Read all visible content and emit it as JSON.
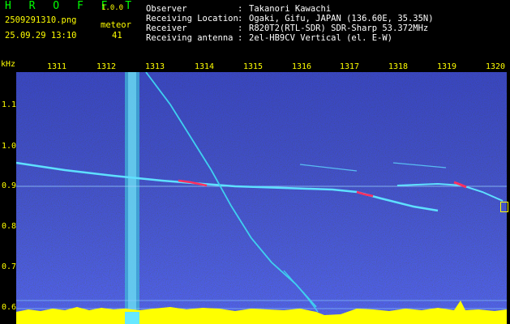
{
  "app": {
    "brand": "H R O F F T",
    "version": "1.0.0"
  },
  "file": {
    "name": "2509291310.png",
    "datetime": "25.09.29 13:10"
  },
  "meteor": {
    "label": "meteor",
    "count": "41"
  },
  "info": {
    "observer_label": "Observer",
    "observer_value": "Takanori Kawachi",
    "location_label": "Receiving Location",
    "location_value": "Ogaki, Gifu, JAPAN (136.60E, 35.35N)",
    "receiver_label": "Receiver",
    "receiver_value": "R820T2(RTL-SDR) SDR-Sharp 53.372MHz",
    "antenna_label": "Receiving antenna",
    "antenna_value": "2el-HB9CV Vertical (el. E-W)",
    "colon": ":"
  },
  "axis": {
    "y_unit": "kHz",
    "x_ticks": [
      "1311",
      "1312",
      "1313",
      "1314",
      "1315",
      "1316",
      "1317",
      "1318",
      "1319",
      "1320"
    ],
    "y_ticks": [
      "1.1",
      "1.0",
      "0.9",
      "0.8",
      "0.7",
      "0.6"
    ]
  },
  "colors": {
    "background": "#000000",
    "header_text": "#ffffff",
    "accent": "#ffff00",
    "spectrogram_base": "#1a1f8c",
    "signal": "#00ffff",
    "hot": "#ff3060"
  }
}
